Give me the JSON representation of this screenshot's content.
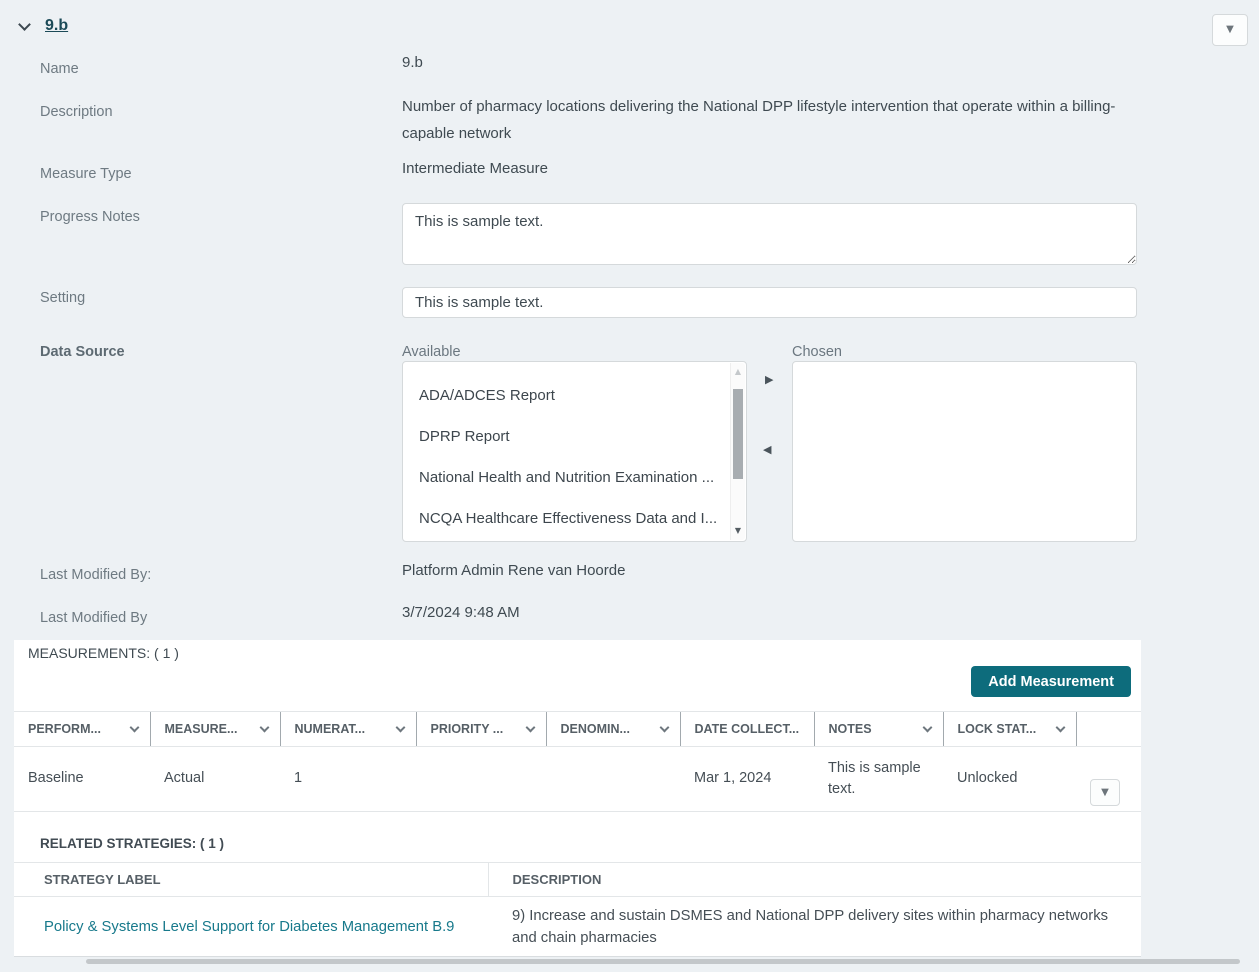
{
  "colors": {
    "accent_teal": "#0d6c7c",
    "link_teal": "#17798b",
    "title_teal": "#1b4a57",
    "page_bg": "#edf1f4"
  },
  "icons": {
    "triangle_down": "▼",
    "triangle_up": "▲",
    "triangle_right": "▶",
    "triangle_left": "◀"
  },
  "section": {
    "title": "9.b"
  },
  "form": {
    "name": {
      "label": "Name",
      "value": "9.b"
    },
    "description": {
      "label": "Description",
      "value": "Number of pharmacy locations delivering the National DPP lifestyle intervention that operate within a billing-capable network"
    },
    "measure_type": {
      "label": "Measure Type",
      "value": "Intermediate Measure"
    },
    "progress_notes": {
      "label": "Progress Notes",
      "value": "This is sample text."
    },
    "setting": {
      "label": "Setting",
      "value": "This is sample text."
    },
    "data_source": {
      "label": "Data Source",
      "available_label": "Available",
      "chosen_label": "Chosen",
      "available_items": [
        "ADA/ADCES Report",
        "DPRP Report",
        "National Health and Nutrition Examination ...",
        "NCQA Healthcare Effectiveness Data and I..."
      ],
      "chosen_items": []
    },
    "last_modified_by_name": {
      "label": "Last Modified By:",
      "value": "Platform Admin Rene van Hoorde"
    },
    "last_modified_by_date": {
      "label": "Last Modified By",
      "value": "3/7/2024 9:48 AM"
    }
  },
  "measurements": {
    "heading": "MEASUREMENTS: ( 1 )",
    "add_button_label": "Add Measurement",
    "columns": [
      "PERFORM...",
      "MEASURE...",
      "NUMERAT...",
      "PRIORITY ...",
      "DENOMIN...",
      "DATE COLLECT...",
      "NOTES",
      "LOCK STAT..."
    ],
    "rows": [
      {
        "performance": "Baseline",
        "measure": "Actual",
        "numerator": "1",
        "priority": "",
        "denominator": "",
        "date_collected": "Mar 1, 2024",
        "notes": "This is sample text.",
        "lock_status": "Unlocked"
      }
    ]
  },
  "related_strategies": {
    "heading": "RELATED STRATEGIES: ( 1 )",
    "columns": [
      "STRATEGY LABEL",
      "DESCRIPTION"
    ],
    "rows": [
      {
        "label": "Policy & Systems Level Support for Diabetes Management B.9",
        "description": "9) Increase and sustain DSMES and National DPP delivery sites within pharmacy networks and chain pharmacies"
      }
    ]
  }
}
